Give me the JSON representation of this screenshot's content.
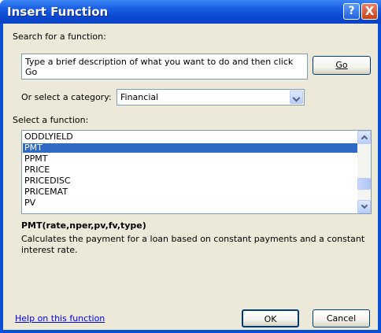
{
  "window": {
    "title": "Insert Function",
    "help_label": "?",
    "close_label": "X"
  },
  "search": {
    "label": "Search for a function:",
    "value": "Type a brief description of what you want to do and then click Go",
    "go_label": "Go"
  },
  "category": {
    "label": "Or select a category:",
    "selected": "Financial"
  },
  "functions": {
    "label": "Select a function:",
    "items": [
      "ODDLYIELD",
      "PMT",
      "PPMT",
      "PRICE",
      "PRICEDISC",
      "PRICEMAT",
      "PV"
    ],
    "selected": "PMT"
  },
  "details": {
    "signature": "PMT(rate,nper,pv,fv,type)",
    "description": "Calculates the payment for a loan based on constant payments and a constant interest rate."
  },
  "footer": {
    "help_link": "Help on this function",
    "ok_label": "OK",
    "cancel_label": "Cancel"
  },
  "colors": {
    "titlebar": "#0a4fd8",
    "dialog_bg": "#ece9d8",
    "selection": "#316ac5",
    "link": "#0000ff"
  }
}
